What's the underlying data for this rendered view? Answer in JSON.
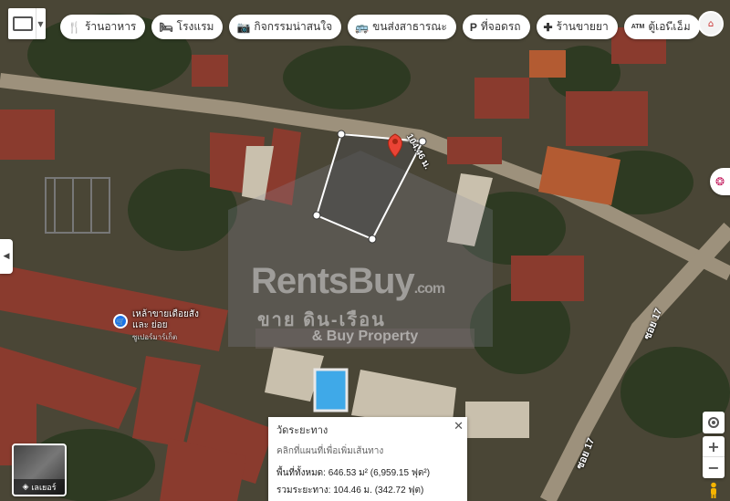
{
  "chips": [
    {
      "icon": "restaurant-icon",
      "glyph": "🍴",
      "label": "ร้านอาหาร"
    },
    {
      "icon": "hotel-icon",
      "glyph": "🛏",
      "label": "โรงแรม"
    },
    {
      "icon": "camera-icon",
      "glyph": "📷",
      "label": "กิจกรรมน่าสนใจ"
    },
    {
      "icon": "transit-icon",
      "glyph": "🚌",
      "label": "ขนส่งสาธารณะ"
    },
    {
      "icon": "parking-icon",
      "glyph": "P",
      "label": "ที่จอดรถ"
    },
    {
      "icon": "pharmacy-icon",
      "glyph": "✚",
      "label": "ร้านขายยา"
    },
    {
      "icon": "atm-icon",
      "glyph": "ATM",
      "label": "ตู้เอทีเอ็ม"
    }
  ],
  "watermark": {
    "logo": "RentsBuy",
    "logo_suffix": ".com",
    "thai": "ขาย ดิน-เรือน",
    "sub": "& Buy Property"
  },
  "measure": {
    "edge_label": "104.46 ม."
  },
  "poi": {
    "store_name_line1": "เหล้าขายเดือยสัง",
    "store_name_line2": "และ ย่อย",
    "store_category": "ซูเปอร์มาร์เก็ต"
  },
  "roads": [
    {
      "label": "ซอย 17"
    },
    {
      "label": "ซอย 17"
    }
  ],
  "info_card": {
    "title": "วัดระยะทาง",
    "hint": "คลิกที่แผนที่เพื่อเพิ่มเส้นทาง",
    "area_text": "พื้นที่ทั้งหมด: 646.53 ม² (6,959.15 ฟุต²)",
    "distance_text": "รวมระยะทาง: 104.46 ม. (342.72 ฟุต)",
    "close_glyph": "✕"
  },
  "layers_label": "เลเยอร์",
  "zoom": {
    "in": "+",
    "out": "−"
  },
  "colors": {
    "roof": "#8a3b2e",
    "roof_orange": "#b85a33",
    "vegetation": "#2f3a24",
    "road": "#9a8e7a",
    "plot_fill": "#4b4b4b",
    "measure_line": "#ffffff",
    "pin": "#ea4335",
    "pool": "#3fa9e8"
  }
}
